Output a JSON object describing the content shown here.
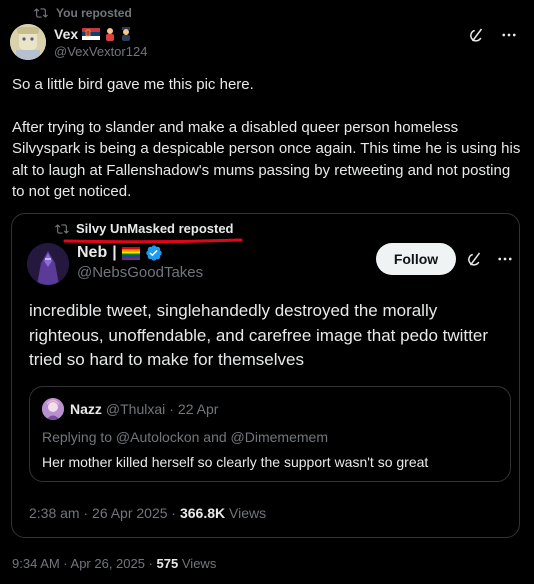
{
  "repost_header": {
    "text": "You reposted",
    "icon": "repost-icon"
  },
  "author": {
    "name": "Vex",
    "handle": "@VexVextor124",
    "badges": [
      "serbia-flag-icon",
      "emoji-person-icon",
      "emoji-cop-icon"
    ]
  },
  "post": {
    "paragraph_1": "So a little bird gave me this pic here.",
    "paragraph_2": "After trying to slander and make a disabled queer person homeless Silvyspark is being a despicable person once again. This time he is using his alt to laugh at Fallenshadow's mums passing by retweeting and not posting to not get noticed."
  },
  "top_actions": {
    "grok_icon": "grok-icon",
    "more_icon": "more-icon"
  },
  "quoted": {
    "repost_label": "Silvy UnMasked reposted",
    "annotation_color": "#e0061a",
    "author_name": "Neb",
    "author_suffix": "|",
    "badges": [
      "rainbow-flag-icon",
      "verified-badge-icon"
    ],
    "handle": "@NebsGoodTakes",
    "follow_label": "Follow",
    "text": "incredible tweet, singlehandedly destroyed the morally righteous, unoffendable, and carefree image that pedo twitter tried so hard to make for themselves",
    "inner_quote": {
      "name": "Nazz",
      "handle": "@Thulxai",
      "separator": "·",
      "date": "22 Apr",
      "replying": "Replying to @Autolockon and @Dimememem",
      "text": "Her mother killed herself so clearly the support wasn't so great"
    },
    "time": "2:38 am · 26 Apr 2025 ·",
    "views_count": "366.8K",
    "views_label": "Views"
  },
  "meta": {
    "time": "9:34 AM · Apr 26, 2025 ·",
    "views_count": "575",
    "views_label": "Views"
  },
  "colors": {
    "background": "#000000",
    "text": "#e7e9ea",
    "muted": "#71767b",
    "border": "#2f3336",
    "verified": "#1d9bf0"
  }
}
